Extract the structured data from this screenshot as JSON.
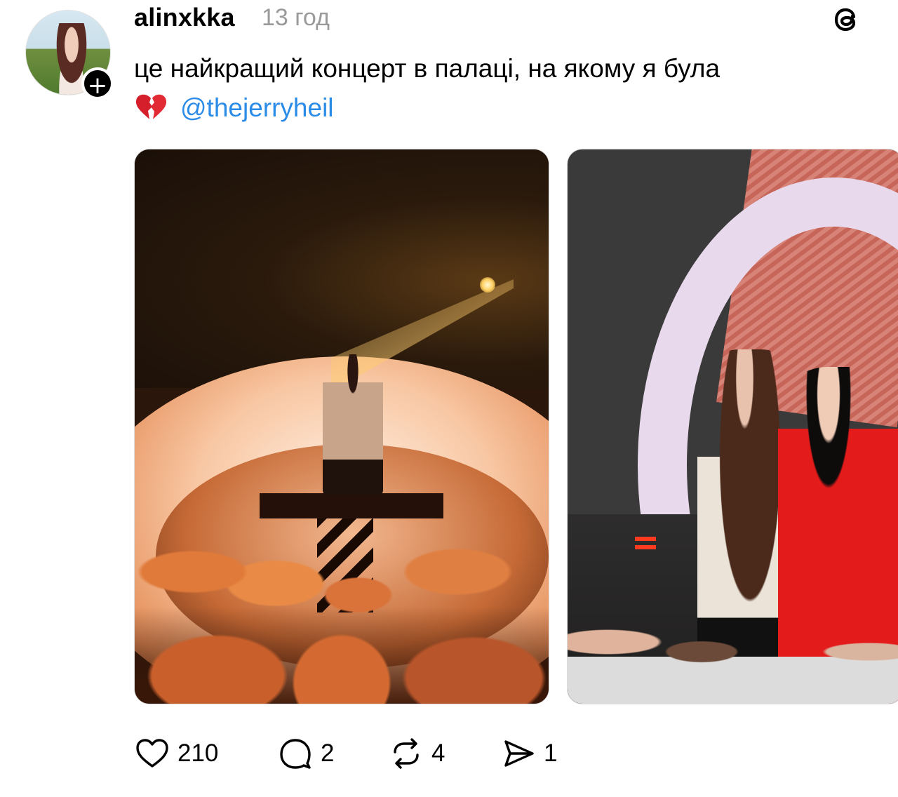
{
  "post": {
    "username": "alinxkka",
    "timestamp": "13 год",
    "text": "це найкращий концерт в палаці, на якому я була",
    "emoji": "💔",
    "mention": "@thejerryheil"
  },
  "follow_badge": "+",
  "icons": {
    "app": "threads-icon",
    "like": "heart-icon",
    "comment": "comment-icon",
    "repost": "repost-icon",
    "share": "share-icon"
  },
  "actions": {
    "likes": "210",
    "comments": "2",
    "reposts": "4",
    "shares": "1"
  },
  "colors": {
    "mention": "#2b8ce8",
    "timestamp": "#9a9a9a"
  }
}
